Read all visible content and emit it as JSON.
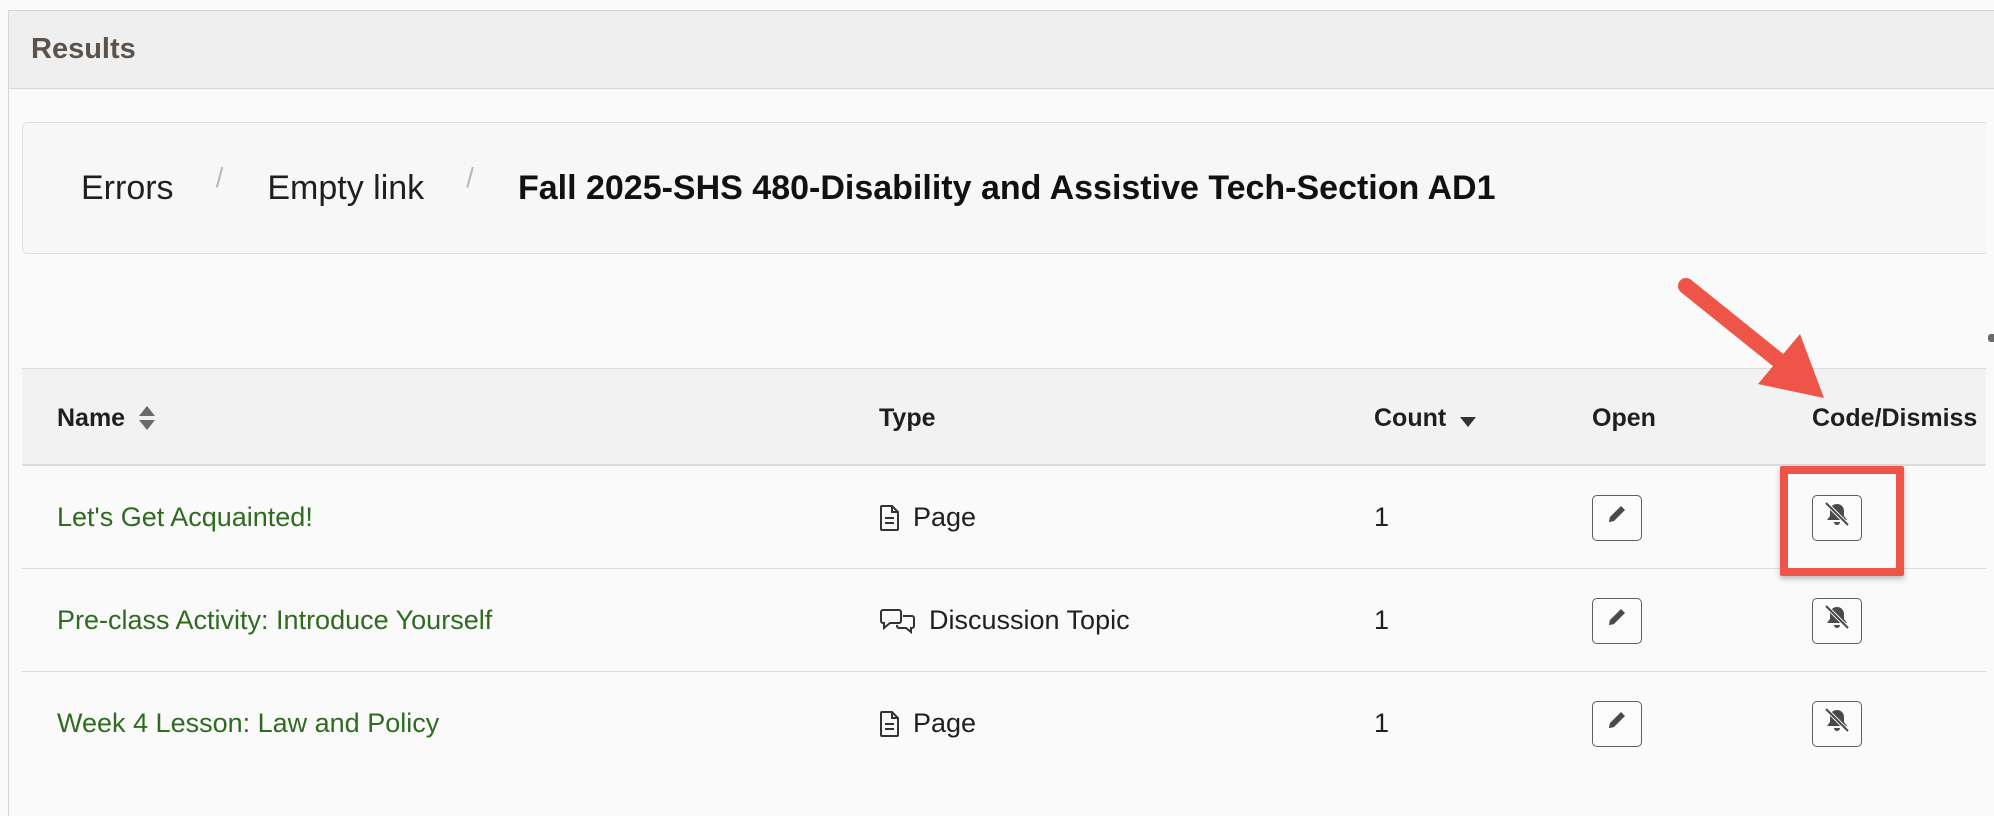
{
  "panel": {
    "title": "Results"
  },
  "breadcrumb": {
    "items": [
      "Errors",
      "Empty link",
      "Fall 2025-SHS 480-Disability and Assistive Tech-Section AD1"
    ],
    "separator": "/"
  },
  "table": {
    "columns": {
      "name": "Name",
      "type": "Type",
      "count": "Count",
      "open": "Open",
      "code_dismiss": "Code/Dismiss"
    },
    "rows": [
      {
        "name": "Let's Get Acquainted!",
        "type": "Page",
        "type_icon": "page-icon",
        "count": "1"
      },
      {
        "name": "Pre-class Activity: Introduce Yourself",
        "type": "Discussion Topic",
        "type_icon": "discussion-icon",
        "count": "1"
      },
      {
        "name": "Week 4 Lesson: Law and Policy",
        "type": "Page",
        "type_icon": "page-icon",
        "count": "1"
      }
    ]
  },
  "colors": {
    "link": "#2e6b1f",
    "annotation": "#ee5448",
    "header_text": "#5b524b"
  }
}
